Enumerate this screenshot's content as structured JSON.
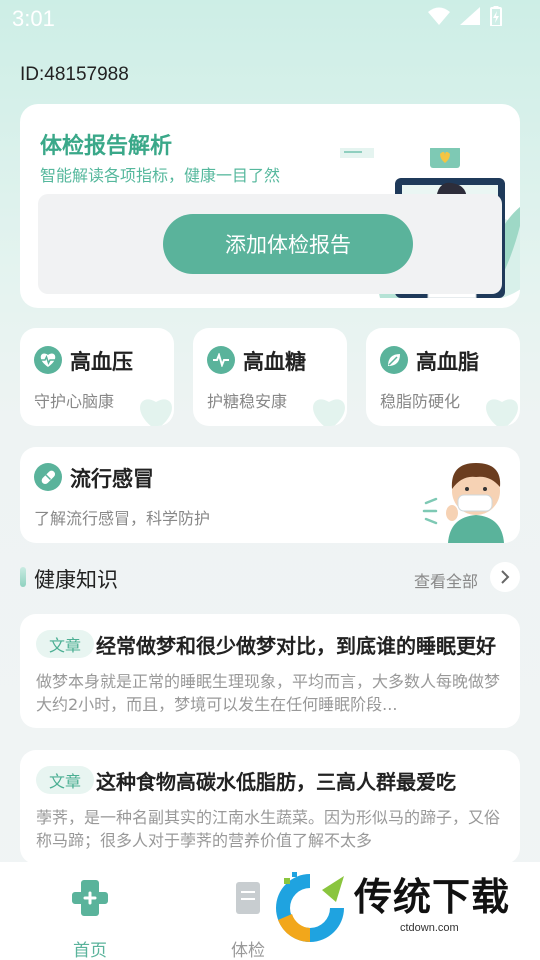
{
  "status_bar": {
    "time": "3:01"
  },
  "user": {
    "id_label": "ID:48157988"
  },
  "report_card": {
    "title": "体检报告解析",
    "subtitle": "智能解读各项指标，健康一目了然",
    "button_label": "添加体检报告"
  },
  "categories": [
    {
      "title": "高血压",
      "subtitle": "守护心脑康",
      "icon": "heart-pulse-icon"
    },
    {
      "title": "高血糖",
      "subtitle": "护糖稳安康",
      "icon": "pulse-icon"
    },
    {
      "title": "高血脂",
      "subtitle": "稳脂防硬化",
      "icon": "leaf-icon"
    }
  ],
  "flu_card": {
    "title": "流行感冒",
    "subtitle": "了解流行感冒，科学防护",
    "icon": "pill-icon"
  },
  "knowledge": {
    "title": "健康知识",
    "view_all": "查看全部",
    "articles": [
      {
        "tag": "文章",
        "title": "经常做梦和很少做梦对比，到底谁的睡眠更好",
        "body": "做梦本身就是正常的睡眠生理现象，平均而言，大多数人每晚做梦大约2小时，而且，梦境可以发生在任何睡眠阶段..."
      },
      {
        "tag": "文章",
        "title": "这种食物高碳水低脂肪，三高人群最爱吃",
        "body": "荸荠，是一种名副其实的江南水生蔬菜。因为形似马的蹄子，又俗称马蹄；很多人对于荸荠的营养价值了解不太多"
      }
    ]
  },
  "bottom_nav": {
    "items": [
      {
        "label": "首页",
        "icon": "home-cross-icon",
        "active": true
      },
      {
        "label": "体检",
        "icon": "report-icon",
        "active": false
      }
    ]
  },
  "watermark": {
    "brand": "传统下载",
    "url": "ctdown.com"
  },
  "colors": {
    "accent": "#5ab39b",
    "title_green": "#3aa889",
    "background": "#eef3f3"
  }
}
